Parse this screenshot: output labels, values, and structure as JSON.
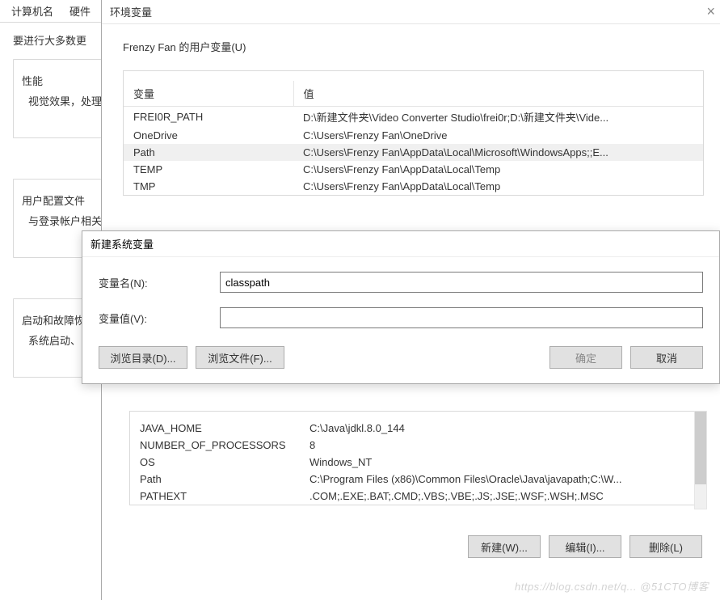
{
  "sysProps": {
    "tabs": [
      "计算机名",
      "硬件"
    ],
    "introText": "要进行大多数更",
    "perf": {
      "label": "性能",
      "sub": "视觉效果，处理"
    },
    "userProfile": {
      "label": "用户配置文件",
      "sub": "与登录帐户相关"
    },
    "startup": {
      "label": "启动和故障恢",
      "sub": "系统启动、"
    }
  },
  "envDialog": {
    "title": "环境变量",
    "userSection": "Frenzy Fan 的用户变量(U)",
    "headers": {
      "name": "变量",
      "value": "值"
    },
    "userVars": [
      {
        "name": "FREI0R_PATH",
        "value": "D:\\新建文件夹\\Video Converter Studio\\frei0r;D:\\新建文件夹\\Vide..."
      },
      {
        "name": "OneDrive",
        "value": "C:\\Users\\Frenzy Fan\\OneDrive"
      },
      {
        "name": "Path",
        "value": "C:\\Users\\Frenzy Fan\\AppData\\Local\\Microsoft\\WindowsApps;;E...",
        "selected": true
      },
      {
        "name": "TEMP",
        "value": "C:\\Users\\Frenzy Fan\\AppData\\Local\\Temp"
      },
      {
        "name": "TMP",
        "value": "C:\\Users\\Frenzy Fan\\AppData\\Local\\Temp"
      }
    ],
    "sysVars": [
      {
        "name": "JAVA_HOME",
        "value": "C:\\Java\\jdkl.8.0_144"
      },
      {
        "name": "NUMBER_OF_PROCESSORS",
        "value": "8"
      },
      {
        "name": "OS",
        "value": "Windows_NT"
      },
      {
        "name": "Path",
        "value": "C:\\Program Files (x86)\\Common Files\\Oracle\\Java\\javapath;C:\\W..."
      },
      {
        "name": "PATHEXT",
        "value": ".COM;.EXE;.BAT;.CMD;.VBS;.VBE;.JS;.JSE;.WSF;.WSH;.MSC"
      }
    ],
    "buttons": {
      "new": "新建(W)...",
      "edit": "编辑(I)...",
      "delete": "删除(L)"
    }
  },
  "newVarDialog": {
    "title": "新建系统变量",
    "labels": {
      "name": "变量名(N):",
      "value": "变量值(V):"
    },
    "fields": {
      "name": "classpath",
      "value": ""
    },
    "buttons": {
      "browseDir": "浏览目录(D)...",
      "browseFile": "浏览文件(F)...",
      "ok": "确定",
      "cancel": "取消"
    }
  },
  "watermark": "https://blog.csdn.net/q... @51CTO博客"
}
